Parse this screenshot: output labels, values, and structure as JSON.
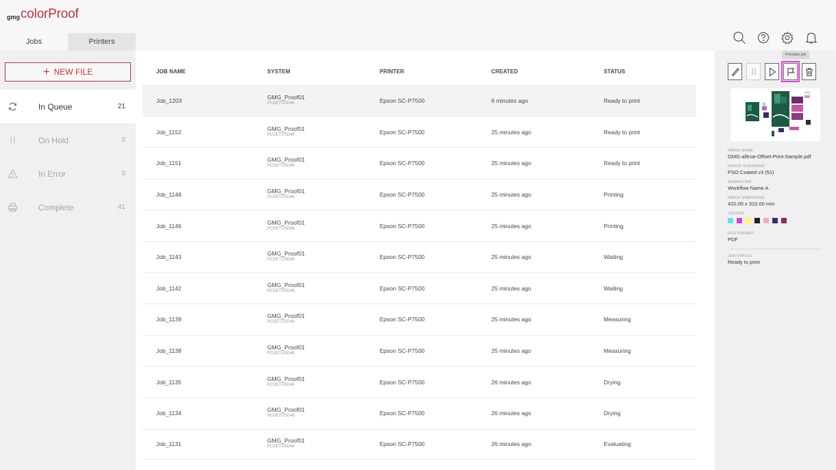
{
  "app": {
    "logo_prefix": "gmg",
    "logo_name": "colorProof"
  },
  "tabs": [
    {
      "label": "Jobs",
      "active": true
    },
    {
      "label": "Printers",
      "active": false
    }
  ],
  "top_icons": [
    "search-icon",
    "help-icon",
    "settings-icon",
    "notification-bell-icon"
  ],
  "sidebar": {
    "new_file_label": "NEW FILE",
    "items": [
      {
        "label": "In Queue",
        "count": "21",
        "icon": "refresh-icon",
        "active": true
      },
      {
        "label": "On Hold",
        "count": "0",
        "icon": "pause-icon",
        "active": false
      },
      {
        "label": "In Error",
        "count": "0",
        "icon": "warning-icon",
        "active": false
      },
      {
        "label": "Complete",
        "count": "41",
        "icon": "printer-icon",
        "active": false
      }
    ]
  },
  "table": {
    "columns": [
      "JOB NAME",
      "SYSTEM",
      "PRINTER",
      "CREATED",
      "STATUS"
    ],
    "rows": [
      {
        "job": "Job_1203",
        "system": "GMG_Proof01",
        "system_code": "PCDETUSD46",
        "printer": "Epson SC-P7500",
        "created": "6 minutes ago",
        "status": "Ready to print",
        "selected": true
      },
      {
        "job": "Job_1152",
        "system": "GMG_Proof01",
        "system_code": "PCDETUSD46",
        "printer": "Epson SC-P7500",
        "created": "25 minutes ago",
        "status": "Ready to print"
      },
      {
        "job": "Job_1151",
        "system": "GMG_Proof01",
        "system_code": "PCDETUSD46",
        "printer": "Epson SC-P7500",
        "created": "25 minutes ago",
        "status": "Ready to print"
      },
      {
        "job": "Job_1148",
        "system": "GMG_Proof01",
        "system_code": "PCDETUSD46",
        "printer": "Epson SC-P7500",
        "created": "25 minutes ago",
        "status": "Printing"
      },
      {
        "job": "Job_1146",
        "system": "GMG_Proof01",
        "system_code": "PCDETUSD46",
        "printer": "Epson SC-P7500",
        "created": "25 minutes ago",
        "status": "Printing"
      },
      {
        "job": "Job_1143",
        "system": "GMG_Proof01",
        "system_code": "PCDETUSD46",
        "printer": "Epson SC-P7500",
        "created": "25 minutes ago",
        "status": "Waiting"
      },
      {
        "job": "Job_1142",
        "system": "GMG_Proof01",
        "system_code": "PCDETUSD46",
        "printer": "Epson SC-P7500",
        "created": "25 minutes ago",
        "status": "Waiting"
      },
      {
        "job": "Job_1139",
        "system": "GMG_Proof01",
        "system_code": "PCDETUSD46",
        "printer": "Epson SC-P7500",
        "created": "25 minutes ago",
        "status": "Measuring"
      },
      {
        "job": "Job_1138",
        "system": "GMG_Proof01",
        "system_code": "PCDETUSD46",
        "printer": "Epson SC-P7500",
        "created": "25 minutes ago",
        "status": "Measuring"
      },
      {
        "job": "Job_1135",
        "system": "GMG_Proof01",
        "system_code": "PCDETUSD46",
        "printer": "Epson SC-P7500",
        "created": "26 minutes ago",
        "status": "Drying"
      },
      {
        "job": "Job_1134",
        "system": "GMG_Proof01",
        "system_code": "PCDETUSD46",
        "printer": "Epson SC-P7500",
        "created": "26 minutes ago",
        "status": "Drying"
      },
      {
        "job": "Job_1131",
        "system": "GMG_Proof01",
        "system_code": "PCDETUSD46",
        "printer": "Epson SC-P7500",
        "created": "26 minutes ago",
        "status": "Evaluating"
      }
    ]
  },
  "details": {
    "tooltip": "Prioritize job",
    "actions": [
      "edit-icon",
      "pause-icon",
      "play-icon",
      "flag-icon",
      "trash-icon"
    ],
    "image_name_label": "IMAGE NAME",
    "image_name": "GMG-alltrue-Offset-Print-Sample.pdf",
    "proof_standard_label": "PROOF STANDARD",
    "proof_standard": "PSO Coated v3 (51)",
    "workflow_label": "WORKFLOW",
    "workflow": "Workflow Name A",
    "image_dimension_label": "IMAGE DIMENSION",
    "image_dimension": "420.00 x 310.00 mm",
    "colors_label": "COLORS",
    "colors": [
      "#5fe3f0",
      "#d63fd6",
      "#fff86a",
      "#222222",
      "#f2a9c4",
      "#3a2a6b",
      "#8a2a6a"
    ],
    "file_format_label": "FILE FORMAT",
    "file_format": "PDF",
    "job_status_label": "JOB STATUS",
    "job_status": "Ready to print"
  },
  "colors": {
    "accent": "#c0323b",
    "highlight": "#e23de0"
  }
}
